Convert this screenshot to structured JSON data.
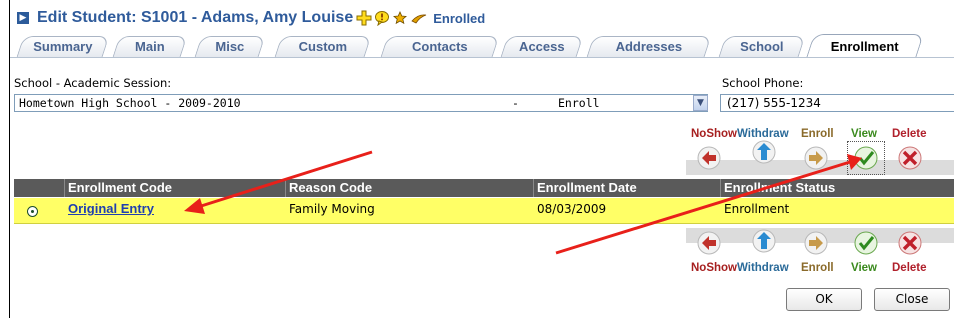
{
  "header": {
    "title": "Edit Student: S1001 - Adams, Amy Louise",
    "status": "Enrolled",
    "icons": [
      "plus-cross-icon",
      "alert-bubble-icon",
      "star-icon",
      "swoosh-icon"
    ]
  },
  "tabs": [
    {
      "label": "Summary",
      "active": false
    },
    {
      "label": "Main",
      "active": false
    },
    {
      "label": "Misc",
      "active": false
    },
    {
      "label": "Custom",
      "active": false
    },
    {
      "label": "Contacts",
      "active": false
    },
    {
      "label": "Access",
      "active": false
    },
    {
      "label": "Addresses",
      "active": false
    },
    {
      "label": "School",
      "active": false
    },
    {
      "label": "Enrollment",
      "active": true
    }
  ],
  "school_session": {
    "label": "School - Academic Session:",
    "value_school": "Hometown High School - 2009-2010",
    "value_dash": "-",
    "value_status": "Enroll"
  },
  "school_phone": {
    "label": "School Phone:",
    "value": "(217) 555-1234"
  },
  "actions": {
    "noshow": "NoShow",
    "withdraw": "Withdraw",
    "enroll": "Enroll",
    "view": "View",
    "delete": "Delete"
  },
  "grid": {
    "columns": [
      "Enrollment Code",
      "Reason Code",
      "Enrollment Date",
      "Enrollment Status"
    ],
    "rows": [
      {
        "enrollment_code": "Original Entry",
        "reason_code": "Family Moving",
        "enrollment_date": "08/03/2009",
        "enrollment_status": "Enrollment"
      }
    ]
  },
  "buttons": {
    "ok": "OK",
    "close": "Close"
  },
  "colors": {
    "title": "#2f5b9b",
    "header_bg": "#5a5a5a",
    "row_highlight": "#ffff66",
    "annotation_arrow": "#e8201a"
  }
}
